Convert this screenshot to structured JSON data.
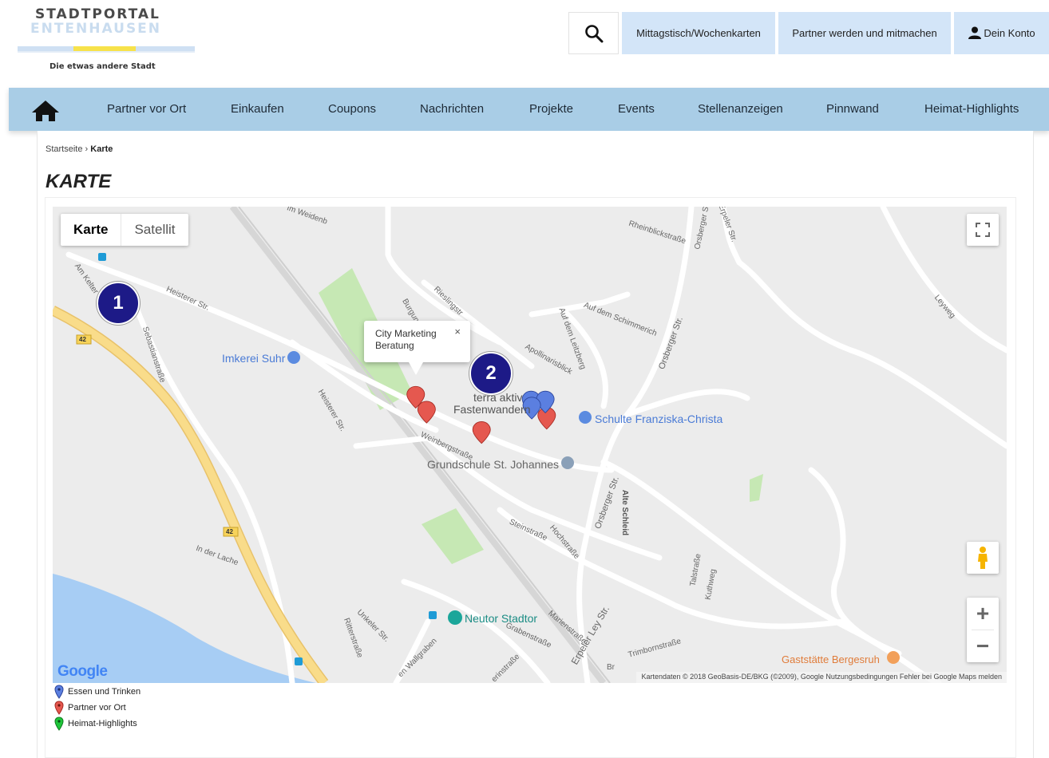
{
  "logo": {
    "line1": "STADTPORTAL",
    "line2": "ENTENHAUSEN",
    "tagline": "Die etwas andere Stadt"
  },
  "topbar": {
    "search_icon": "search-icon",
    "btn_menu": "Mittagstisch/Wochenkarten",
    "btn_partner": "Partner werden und mitmachen",
    "btn_account": "Dein Konto"
  },
  "nav": {
    "home_icon": "home-icon",
    "items": [
      "Partner vor Ort",
      "Einkaufen",
      "Coupons",
      "Nachrichten",
      "Projekte",
      "Events",
      "Stellenanzeigen",
      "Pinnwand",
      "Heimat-Highlights"
    ]
  },
  "breadcrumb": {
    "home": "Startseite",
    "sep": "›",
    "current": "Karte"
  },
  "page": {
    "title": "KARTE"
  },
  "map": {
    "type_map": "Karte",
    "type_satellite": "Satellit",
    "infowindow_text": "City Marketing Beratung",
    "infowindow_close": "×",
    "badge1": "1",
    "badge2": "2",
    "streets": {
      "im_weiden": "Im Weidenb",
      "rheinblick": "Rheinblickstraße",
      "orsberger_top": "Orsberger St",
      "erpeler_top": "Erpeler Str.",
      "heisterer": "Heisterer Str.",
      "am_kelter": "Am Kelter",
      "sebastian": "Sebastianstraße",
      "riesling": "Rieslingstr",
      "burgun": "Burgun",
      "aufdem": "Auf dem Schimmerich",
      "leitzberg": "Auf dem Leitzberg",
      "apollinaris": "Apollinarisblick",
      "orsberger_mid": "Orsberger Str.",
      "leyweg": "Leyweg",
      "heisterer2": "Heisterer Str.",
      "weinberg": "Weinbergstraße",
      "steinstr": "Steinstraße",
      "hochstr": "Hochstraße",
      "orsberger_low": "Orsberger Str.",
      "alte_schleid": "Alte Schleid",
      "talstr": "Talstraße",
      "kuthweg": "Kuthweg",
      "in_der_lache": "In der Lache",
      "unkeler": "Unkeler Str.",
      "ritter": "Ritterstraße",
      "wallgraben": "en Wallgraben",
      "graben": "Grabenstraße",
      "marien": "Marienstraße",
      "erpeler_ley": "Erpeler Ley Str.",
      "trimborn": "Trimbornstraße",
      "gerin": "erinstraße",
      "br": "Br",
      "road42a": "42",
      "road42b": "42"
    },
    "pois": {
      "imkerei": "Imkerei Suhr",
      "terra": "terra aktiv",
      "fasten": "Fastenwandern",
      "schulte": "Schulte Franziska-Christa",
      "grundschule": "Grundschule St. Johannes",
      "neutor": "Neutor Stadtor",
      "gaststaette": "Gaststätte Bergesruh"
    },
    "google": "Google",
    "attribution": "Kartendaten © 2018 GeoBasis-DE/BKG (©2009), Google    Nutzungsbedingungen    Fehler bei Google Maps melden",
    "zoom_in": "+",
    "zoom_out": "−"
  },
  "legend": {
    "items": [
      {
        "label": "Essen und Trinken",
        "color": "#5b7fe0"
      },
      {
        "label": "Partner vor Ort",
        "color": "#e5584f"
      },
      {
        "label": "Heimat-Highlights",
        "color": "#1fc63a"
      }
    ]
  },
  "colors": {
    "nav_bg": "#a9cde6",
    "top_btn_bg": "#d3e5f8",
    "badge_bg": "#1d1a87",
    "marker_red": "#e5584f",
    "marker_blue": "#5b7fe0",
    "road_yellow": "#f9dc8a",
    "water": "#a7cdf4",
    "park": "#c6e8b4"
  }
}
